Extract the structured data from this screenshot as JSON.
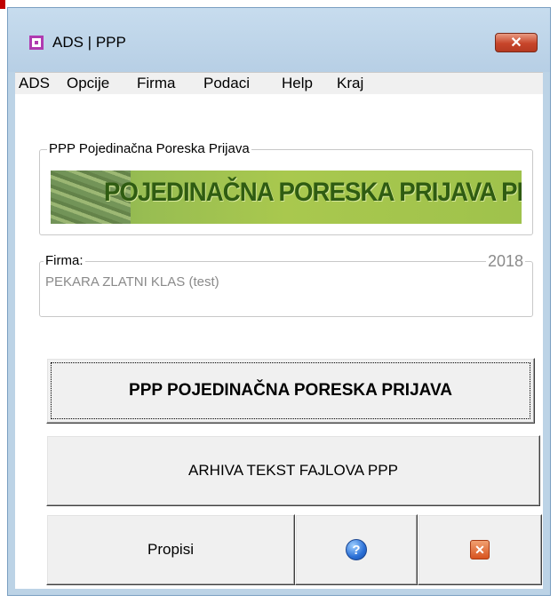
{
  "window": {
    "title": "ADS | PPP",
    "close_glyph": "✕"
  },
  "menu": {
    "items": [
      "ADS",
      "Opcije",
      "Firma",
      "Podaci",
      "Help",
      "Kraj"
    ]
  },
  "ppp_group": {
    "legend": "PPP Pojedinačna Poreska Prijava",
    "banner_text": "POJEDINAČNA PORESKA PRIJAVA PPP"
  },
  "firma_group": {
    "legend": "Firma:",
    "year": "2018",
    "value": "PEKARA ZLATNI KLAS (test)"
  },
  "buttons": {
    "main": "PPP POJEDINAČNA PORESKA PRIJAVA",
    "arhiva": "ARHIVA TEKST FAJLOVA PPP",
    "propisi": "Propisi",
    "help_icon": "help-icon",
    "help_glyph": "?",
    "exit_icon": "exit-icon",
    "exit_glyph": "✕"
  },
  "colors": {
    "titlebar": "#bcd3e6",
    "banner_text": "#2f5c12",
    "close_button": "#c7452a"
  }
}
